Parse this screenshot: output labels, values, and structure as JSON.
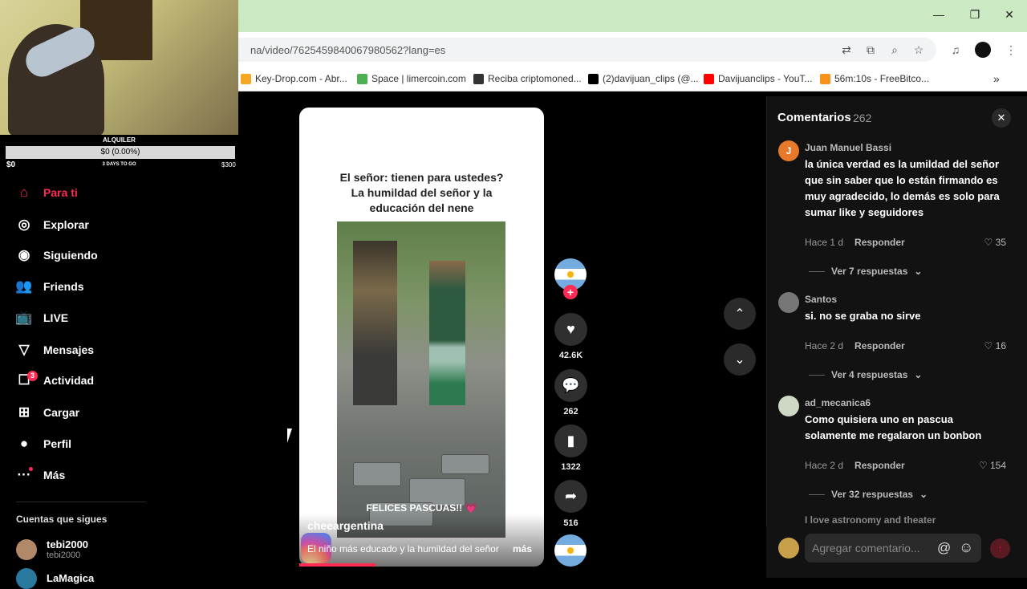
{
  "browser": {
    "url": "na/video/7625459840067980562?lang=es",
    "window_controls": {
      "minimize": "—",
      "restore": "❐",
      "close": "✕"
    },
    "bookmarks": [
      {
        "label": "Key-Drop.com - Abr...",
        "color": "#f5a623"
      },
      {
        "label": "Space | limercoin.com",
        "color": "#4caf50"
      },
      {
        "label": "Reciba criptomoned...",
        "color": "#333333"
      },
      {
        "label": "(2)davijuan_clips (@...",
        "color": "#000000"
      },
      {
        "label": "Davijuanclips - YouT...",
        "color": "#ff0000"
      },
      {
        "label": "56m:10s - FreeBitco...",
        "color": "#f7931a"
      }
    ],
    "more": "»"
  },
  "overlay": {
    "label": "ALQUILER",
    "bar_text": "$0 (0.00%)",
    "min": "$0",
    "days": "3 DAYS TO GO",
    "max": "$300",
    "progress": 0
  },
  "sidebar": {
    "items": [
      {
        "label": "Para ti",
        "icon": "home-icon",
        "glyph": "⌂"
      },
      {
        "label": "Explorar",
        "icon": "compass-icon",
        "glyph": "◎"
      },
      {
        "label": "Siguiendo",
        "icon": "following-avatar-icon",
        "glyph": "◉"
      },
      {
        "label": "Friends",
        "icon": "friends-icon",
        "glyph": "👥"
      },
      {
        "label": "LIVE",
        "icon": "live-tv-icon",
        "glyph": "📺"
      },
      {
        "label": "Mensajes",
        "icon": "send-icon",
        "glyph": "▽"
      },
      {
        "label": "Actividad",
        "icon": "activity-icon",
        "glyph": "☐"
      },
      {
        "label": "Cargar",
        "icon": "upload-plus-icon",
        "glyph": "⊞"
      },
      {
        "label": "Perfil",
        "icon": "profile-avatar-icon",
        "glyph": "●"
      },
      {
        "label": "Más",
        "icon": "more-dots-icon",
        "glyph": "···"
      }
    ],
    "activity_badge": "3",
    "following_title": "Cuentas que sigues",
    "accounts": [
      {
        "name": "tebi2000",
        "handle": "tebi2000"
      },
      {
        "name": "LaMagica",
        "handle": ""
      }
    ]
  },
  "video": {
    "caption": "El señor: tienen para ustedes?\nLa humildad del señor y la\neducación del nene",
    "overlay_text": "FELICES PASCUAS!! 💗",
    "author": "cheeargentina",
    "description": "El niño más educado y la humildad del señor",
    "more": "más",
    "progress": 0.31
  },
  "actions": {
    "likes": "42.6K",
    "comments": "262",
    "saves": "1322",
    "shares": "516",
    "follow_plus": "+"
  },
  "comments": {
    "title": "Comentarios",
    "count": "262",
    "close": "✕",
    "items": [
      {
        "user": "Juan Manuel Bassi",
        "avatar_color": "#e8782a",
        "avatar_letter": "J",
        "text": "la única verdad es la umildad del señor que sin saber que lo están firmando es muy agradecido, lo demás es solo para sumar like y seguidores",
        "time": "Hace 1 d",
        "reply": "Responder",
        "likes": "35",
        "replies": "Ver 7 respuestas"
      },
      {
        "user": "Santos",
        "avatar_color": "#777777",
        "avatar_letter": "",
        "text": "si. no se graba no sirve",
        "time": "Hace 2 d",
        "reply": "Responder",
        "likes": "16",
        "replies": "Ver 4 respuestas"
      },
      {
        "user": "ad_mecanica6",
        "avatar_color": "#cfd8c4",
        "avatar_letter": "",
        "text": "Como quisiera uno en pascua solamente me regalaron un bonbon",
        "time": "Hace 2 d",
        "reply": "Responder",
        "likes": "154",
        "replies": "Ver 32 respuestas"
      }
    ],
    "partial": "I love astronomy and theater",
    "input_placeholder": "Agregar comentario...",
    "at": "@",
    "emoji": "☺",
    "send": "↑"
  }
}
